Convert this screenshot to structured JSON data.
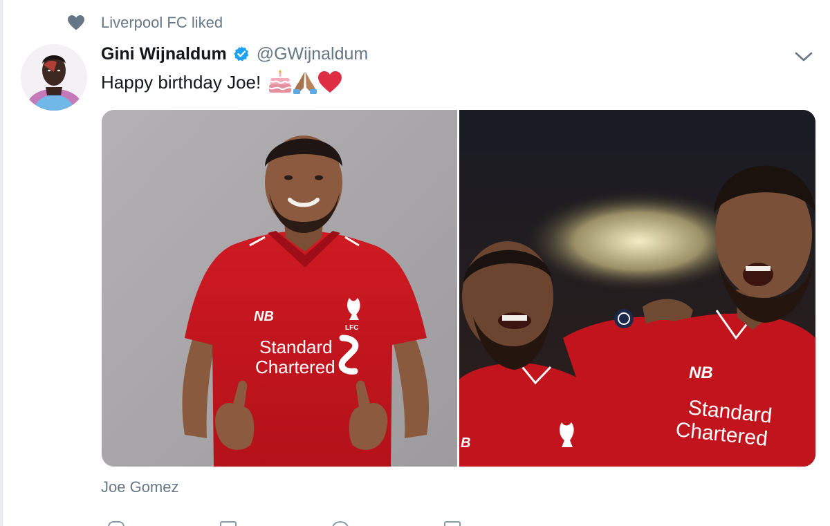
{
  "context": {
    "text": "Liverpool FC liked",
    "icon": "heart-icon"
  },
  "tweet": {
    "author_name": "Gini Wijnaldum",
    "handle": "@GWijnaldum",
    "verified": true,
    "text": "Happy birthday Joe!",
    "emojis": [
      "birthday-cake-emoji",
      "folded-hands-emoji",
      "red-heart-emoji"
    ]
  },
  "media": {
    "count": 2,
    "left_photo": {
      "jersey_sponsor_line1": "Standard",
      "jersey_sponsor_line2": "Chartered"
    },
    "right_photo": {
      "jersey_sponsor_line1": "Standard",
      "jersey_sponsor_line2": "Chartered"
    }
  },
  "caption": "Joe Gomez",
  "colors": {
    "muted_text": "#657786",
    "primary_text": "#14171a",
    "verified_blue": "#1da1f2",
    "liverpool_red": "#c8102e"
  }
}
